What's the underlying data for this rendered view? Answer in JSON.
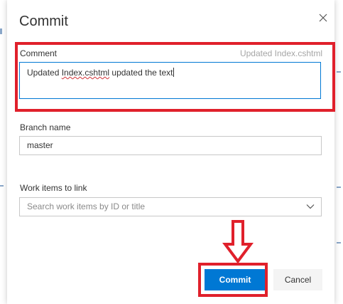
{
  "dialog": {
    "title": "Commit",
    "comment": {
      "label": "Comment",
      "hint": "Updated Index.cshtml",
      "text_before": "Updated ",
      "text_spell": "Index.cshtml",
      "text_after": " updated the text"
    },
    "branch": {
      "label": "Branch name",
      "value": "master"
    },
    "work_items": {
      "label": "Work items to link",
      "placeholder": "Search work items by ID or title"
    },
    "buttons": {
      "commit": "Commit",
      "cancel": "Cancel"
    }
  },
  "colors": {
    "primary": "#0078d4",
    "highlight": "#e0202b"
  },
  "icons": {
    "close": "close-icon",
    "chevron": "chevron-down-icon",
    "annotation_arrow": "down-arrow-icon"
  }
}
